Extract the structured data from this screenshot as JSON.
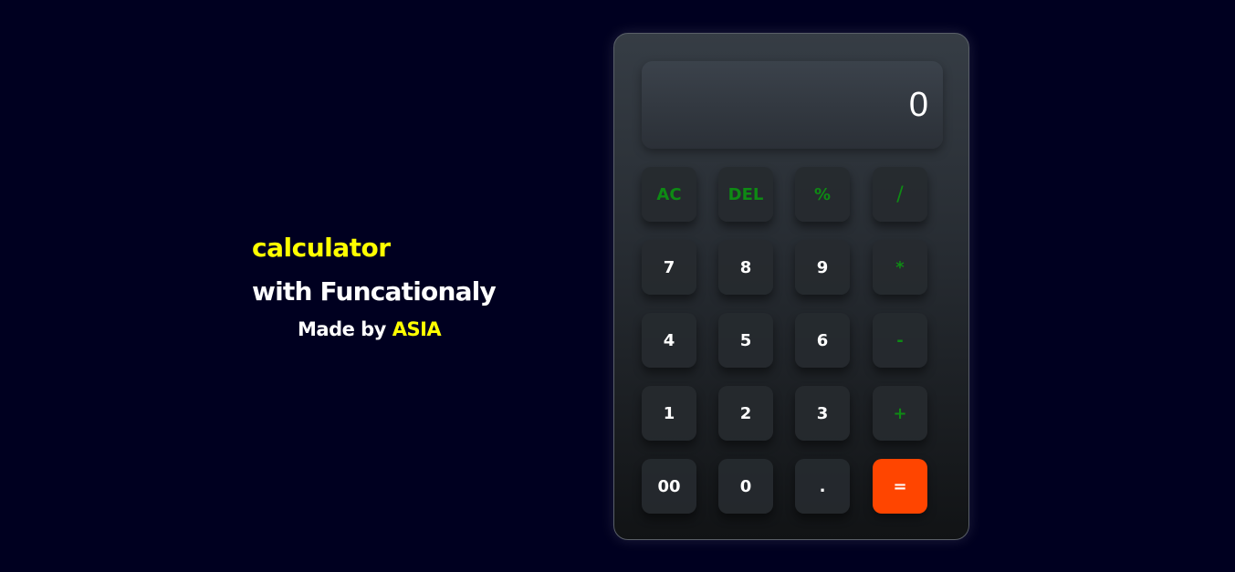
{
  "intro": {
    "title": "calculator",
    "subtitle": "with Funcationaly",
    "made_by_prefix": "Made by",
    "author": "ASIA"
  },
  "calculator": {
    "display_value": "0",
    "rows": [
      [
        {
          "label": "AC",
          "kind": "op"
        },
        {
          "label": "DEL",
          "kind": "op"
        },
        {
          "label": "%",
          "kind": "op"
        },
        {
          "label": "/",
          "kind": "op"
        }
      ],
      [
        {
          "label": "7",
          "kind": "num"
        },
        {
          "label": "8",
          "kind": "num"
        },
        {
          "label": "9",
          "kind": "num"
        },
        {
          "label": "*",
          "kind": "op"
        }
      ],
      [
        {
          "label": "4",
          "kind": "num"
        },
        {
          "label": "5",
          "kind": "num"
        },
        {
          "label": "6",
          "kind": "num"
        },
        {
          "label": "-",
          "kind": "op"
        }
      ],
      [
        {
          "label": "1",
          "kind": "num"
        },
        {
          "label": "2",
          "kind": "num"
        },
        {
          "label": "3",
          "kind": "num"
        },
        {
          "label": "+",
          "kind": "op"
        }
      ],
      [
        {
          "label": "00",
          "kind": "num"
        },
        {
          "label": "0",
          "kind": "num"
        },
        {
          "label": ".",
          "kind": "num"
        },
        {
          "label": "=",
          "kind": "equals"
        }
      ]
    ]
  },
  "colors": {
    "background": "#000020",
    "accent_yellow": "#ffff00",
    "operator_green": "#0e8a14",
    "equals_orange": "#ff4500"
  }
}
